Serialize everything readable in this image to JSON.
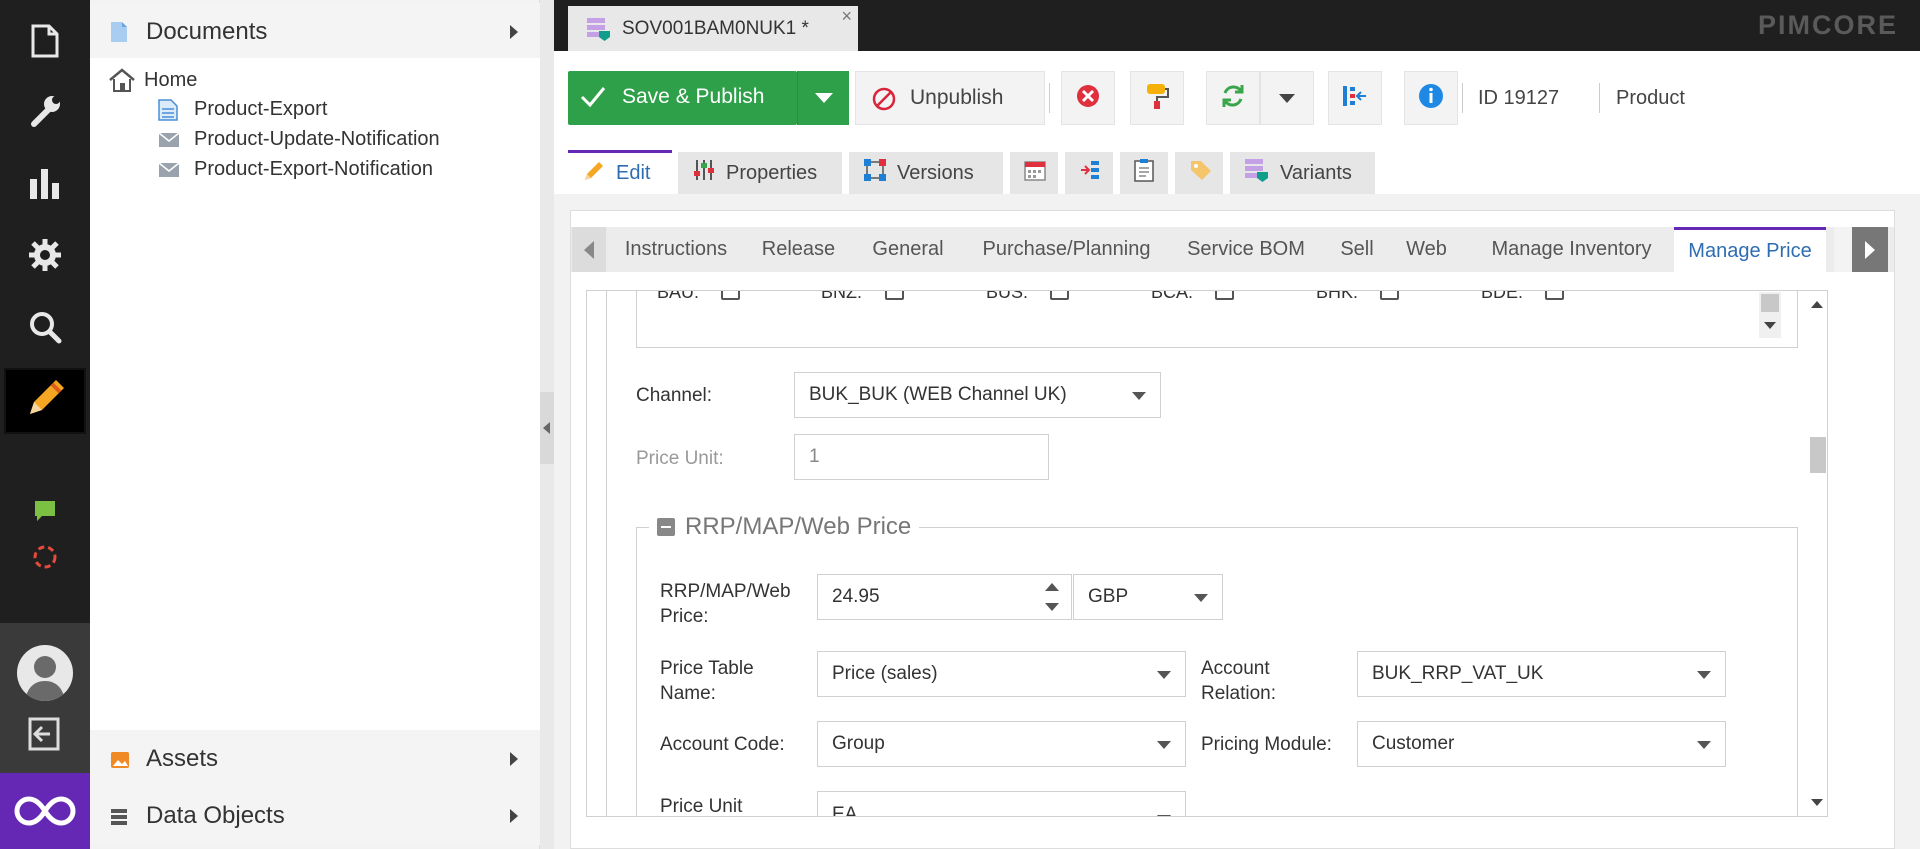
{
  "app": {
    "brand": "PIMCORE"
  },
  "left_toolbar": {
    "items": [
      "documents-icon",
      "tools-icon",
      "reports-icon",
      "settings-icon",
      "search-icon",
      "edit-icon",
      "chat-icon",
      "sync-icon"
    ]
  },
  "tree": {
    "documents": {
      "title": "Documents"
    },
    "nodes": [
      {
        "label": "Home",
        "icon": "home-icon"
      },
      {
        "label": "Product-Export",
        "icon": "page-icon"
      },
      {
        "label": "Product-Update-Notification",
        "icon": "email-icon"
      },
      {
        "label": "Product-Export-Notification",
        "icon": "email-icon"
      }
    ],
    "assets": {
      "title": "Assets"
    },
    "data_objects": {
      "title": "Data Objects"
    }
  },
  "doc_tab": {
    "title": "SOV001BAM0NUK1 *",
    "close": "×"
  },
  "toolbar": {
    "save_publish": "Save & Publish",
    "unpublish": "Unpublish",
    "id_text": "ID 19127",
    "class_text": "Product"
  },
  "content_tabs": [
    {
      "label": "Edit"
    },
    {
      "label": "Properties"
    },
    {
      "label": "Versions"
    },
    {
      "label": ""
    },
    {
      "label": ""
    },
    {
      "label": ""
    },
    {
      "label": ""
    },
    {
      "label": "Variants"
    }
  ],
  "sub_tabs": [
    "Instructions",
    "Release",
    "General",
    "Purchase/Planning",
    "Service BOM",
    "Sell",
    "Web",
    "Manage Inventory",
    "Manage Price"
  ],
  "form": {
    "checkboxes": [
      "BAU:",
      "BNZ:",
      "BUS:",
      "BCA:",
      "BHK:",
      "BDE:"
    ],
    "channel": {
      "label": "Channel:",
      "value": "BUK_BUK (WEB Channel UK)"
    },
    "price_unit": {
      "label": "Price Unit:",
      "value": "1"
    },
    "section": {
      "title": "RRP/MAP/Web Price"
    },
    "rrp_price": {
      "label_line1": "RRP/MAP/Web",
      "label_line2": "Price:",
      "value": "24.95",
      "currency": "GBP"
    },
    "price_table": {
      "label_line1": "Price Table",
      "label_line2": "Name:",
      "value": "Price (sales)"
    },
    "account_relation": {
      "label_line1": "Account",
      "label_line2": "Relation:",
      "value": "BUK_RRP_VAT_UK"
    },
    "account_code": {
      "label": "Account Code:",
      "value": "Group"
    },
    "pricing_module": {
      "label": "Pricing Module:",
      "value": "Customer"
    },
    "price_unit2": {
      "label": "Price Unit",
      "value": "EA"
    }
  },
  "colors": {
    "accent": "#6428b4",
    "save": "#2fa04a",
    "active_tab_text": "#2e6db4"
  }
}
